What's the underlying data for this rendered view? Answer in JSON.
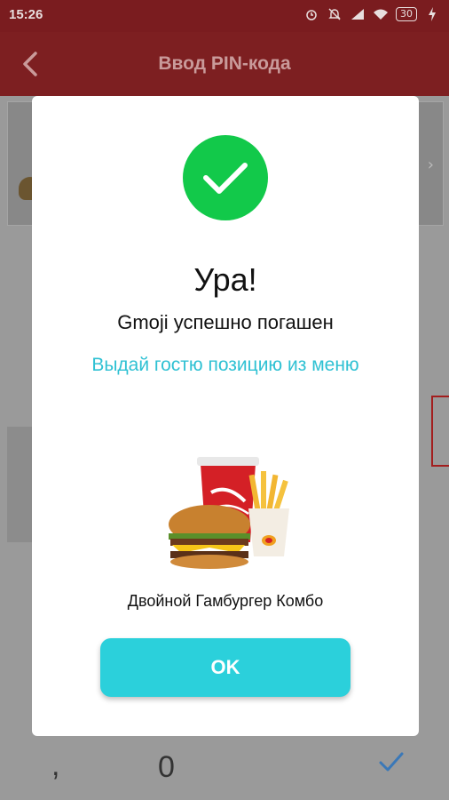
{
  "status_bar": {
    "time": "15:26",
    "battery": "30",
    "icons": [
      "alarm-icon",
      "mute-icon",
      "signal-icon",
      "wifi-icon",
      "battery-icon",
      "charging-icon"
    ]
  },
  "app_bar": {
    "title": "Ввод PIN-кода",
    "color": "#7d1f21"
  },
  "dialog": {
    "title": "Ура!",
    "subtitle": "Gmoji успешно погашен",
    "instruction": "Выдай гостю позицию из меню",
    "product_name": "Двойной Гамбургер Комбо",
    "ok_label": "OK",
    "accent_color": "#2bd0db",
    "success_color": "#12c94a"
  },
  "keypad": {
    "comma": ",",
    "zero": "0"
  }
}
